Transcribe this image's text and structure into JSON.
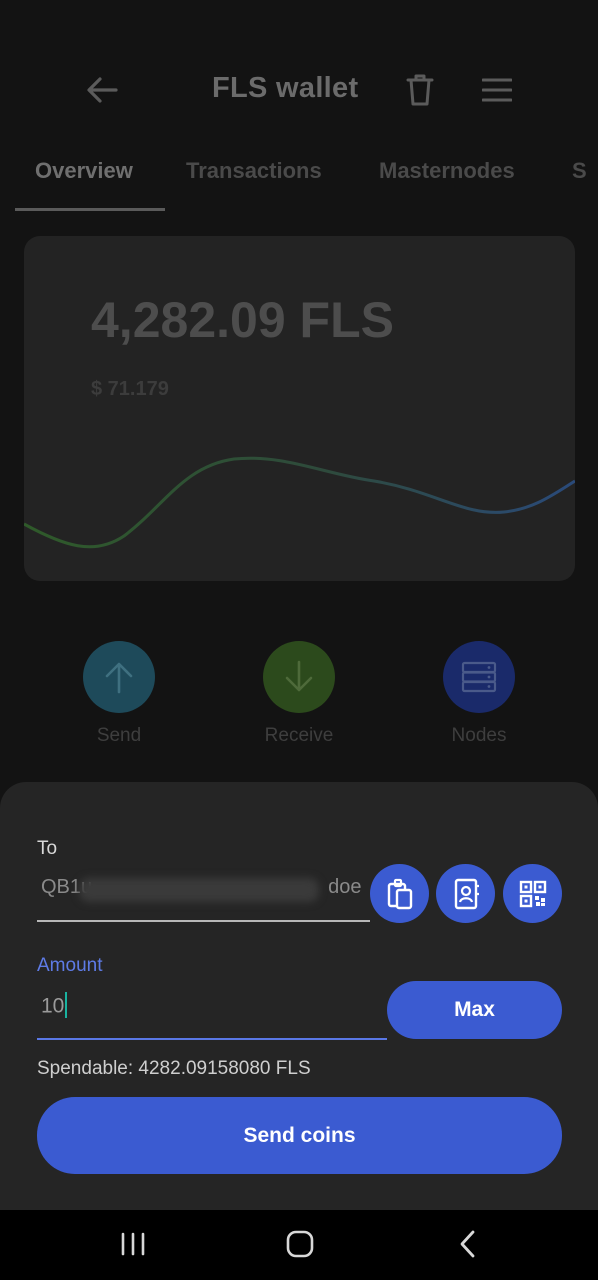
{
  "header": {
    "title": "FLS wallet",
    "back_icon": "arrow-left-icon",
    "trash_icon": "trash-icon",
    "menu_icon": "hamburger-menu-icon"
  },
  "tabs": [
    {
      "label": "Overview",
      "active": true
    },
    {
      "label": "Transactions",
      "active": false
    },
    {
      "label": "Masternodes",
      "active": false
    },
    {
      "label": "S",
      "active": false
    }
  ],
  "balance": {
    "amount": "4,282.09 FLS",
    "fiat": "$ 71.179"
  },
  "actions": {
    "send": {
      "label": "Send",
      "icon": "arrow-up-icon",
      "color": "#1e4a5a"
    },
    "receive": {
      "label": "Receive",
      "icon": "arrow-down-icon",
      "color": "#2c4a1c"
    },
    "nodes": {
      "label": "Nodes",
      "icon": "server-icon",
      "color": "#1a2a6a"
    }
  },
  "send_form": {
    "to_label": "To",
    "to_value": "QB1u",
    "to_value_end": "doe",
    "paste_icon": "clipboard-icon",
    "contacts_icon": "address-book-icon",
    "qr_icon": "qr-code-icon",
    "amount_label": "Amount",
    "amount_value": "10",
    "max_label": "Max",
    "spendable": "Spendable: 4282.09158080 FLS",
    "send_label": "Send coins"
  },
  "colors": {
    "accent": "#3b5bd1",
    "amount_focus": "#5a78e6",
    "caret": "#19b3a0",
    "chart_start": "#2f5a2a",
    "chart_end": "#2a4a7a"
  },
  "system_nav": {
    "recents_icon": "recents-icon",
    "home_icon": "home-icon",
    "back_icon": "back-chevron-icon"
  }
}
